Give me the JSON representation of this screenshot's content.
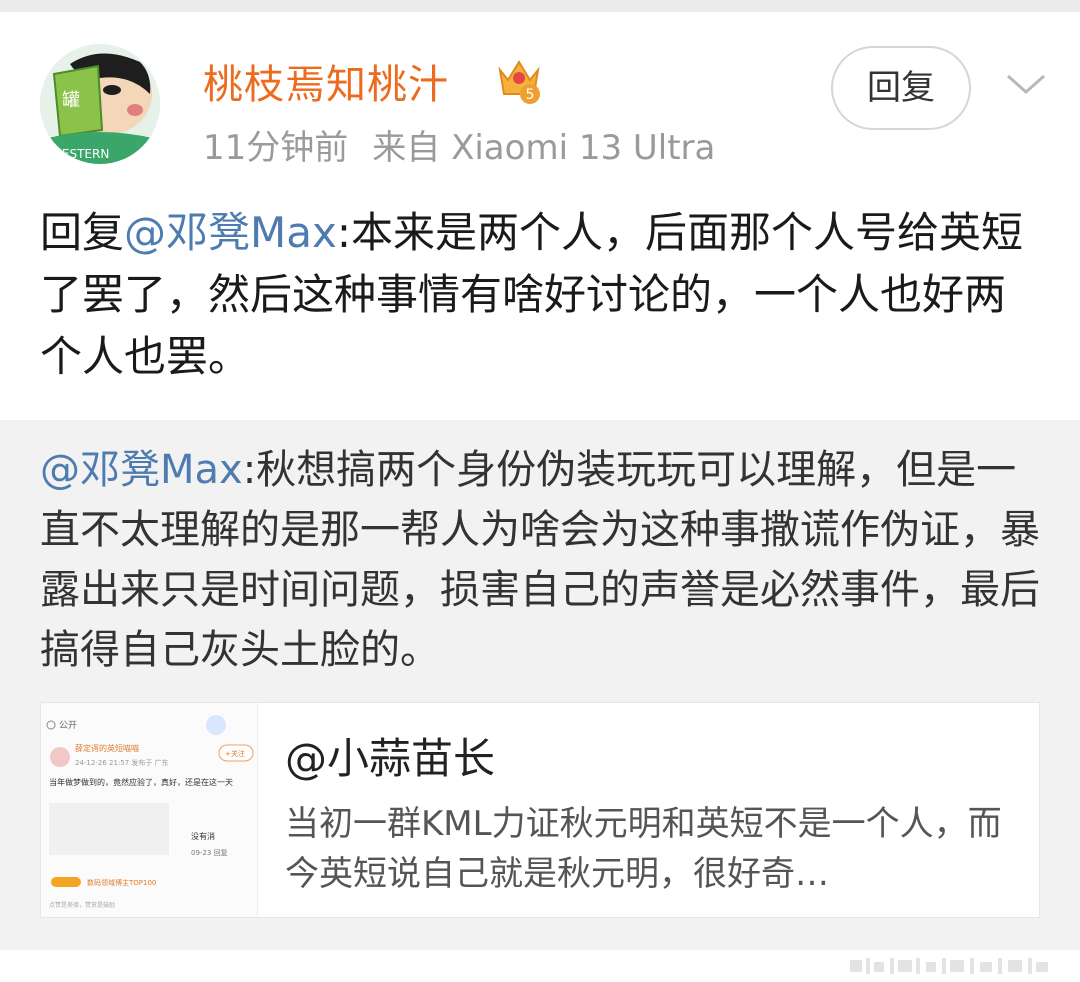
{
  "post": {
    "username": "桃枝焉知桃汁",
    "vip_level": "5",
    "time": "11分钟前",
    "source": "来自 Xiaomi 13 Ultra",
    "reply_button": "回复",
    "text_prefix": "回复",
    "text_mention": "@邓凳Max",
    "text_body": ":本来是两个人，后面那个人号给英短了罢了，然后这种事情有啥好讨论的，一个人也好两个人也罢。"
  },
  "quoted": {
    "mention": "@邓凳Max",
    "body": ":秋想搞两个身份伪装玩玩可以理解，但是一直不太理解的是那一帮人为啥会为这种事撒谎作伪证，暴露出来只是时间问题，损害自己的声誉是必然事件，最后搞得自己灰头土脸的。"
  },
  "linked": {
    "title": "@小蒜苗长",
    "excerpt": "当初一群KML力证秋元明和英短不是一个人，而今英短说自己就是秋元明，很好奇…",
    "thumbnail": {
      "public": "公开",
      "name": "薛定谔的英短喵喵",
      "follow": "+关注",
      "date": "24-12-26 21:57 发布于 广东",
      "text": "当年做梦做到的，竟然应验了，真好，还是在这一天",
      "right1": "没有消",
      "right2": "09-23 回复",
      "tag": "数码领域博主TOP100",
      "footer": "点赞是美德，赞赏是鼓励"
    }
  },
  "colors": {
    "username": "#ec6b1f",
    "mention": "#4e7bb0"
  }
}
